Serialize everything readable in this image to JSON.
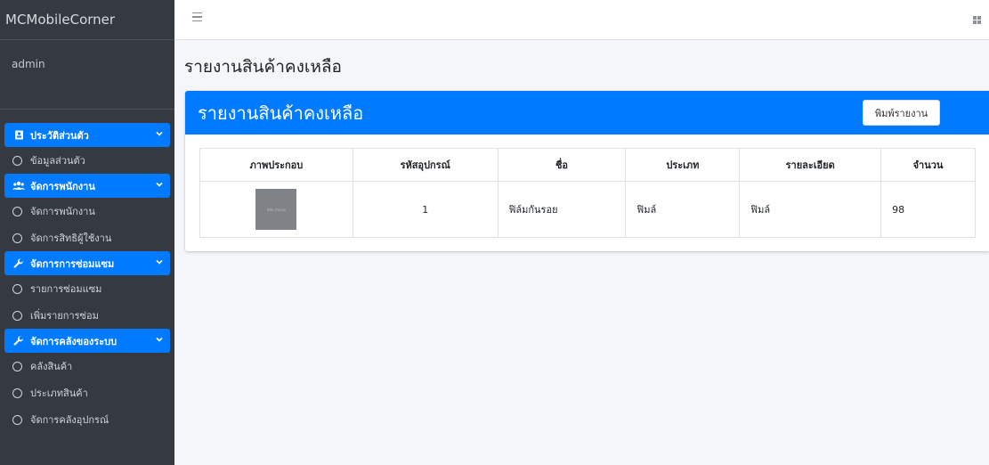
{
  "brand": "MCMobileCorner",
  "user": "admin",
  "sidebar": {
    "groups": [
      {
        "label": "ประวัติส่วนตัว",
        "icon": "id-card-icon",
        "items": [
          "ข้อมูลส่วนตัว"
        ]
      },
      {
        "label": "จัดการพนักงาน",
        "icon": "users-icon",
        "items": [
          "จัดการพนักงาน",
          "จัดการสิทธิผู้ใช้งาน"
        ]
      },
      {
        "label": "จัดการการซ่อมแซม",
        "icon": "wrench-icon",
        "items": [
          "รายการซ่อมแซม",
          "เพิ่มรายการซ่อม"
        ]
      },
      {
        "label": "จัดการคลังของระบบ",
        "icon": "wrench-icon",
        "items": [
          "คลังสินค้า",
          "ประเภทสินค้า",
          "จัดการคลังอุปกรณ์"
        ]
      }
    ]
  },
  "page": {
    "title": "รายงานสินค้าคงเหลือ",
    "card_title": "รายงานสินค้าคงเหลือ",
    "print_label": "พิมพ์รายงาน"
  },
  "table": {
    "headers": [
      "ภาพประกอบ",
      "รหัสอุปกรณ์",
      "ชื่อ",
      "ประเภท",
      "รายละเอียด",
      "จำนวน"
    ],
    "rows": [
      {
        "image_caption": "ฟิล์ม กันรอย",
        "code": "1",
        "name": "ฟิล์มกันรอย",
        "type": "ฟิมล์",
        "detail": "ฟิมล์",
        "qty": "98"
      }
    ]
  },
  "colors": {
    "sidebar_bg": "#343a40",
    "accent": "#007bff",
    "content_bg": "#f4f6f9"
  }
}
